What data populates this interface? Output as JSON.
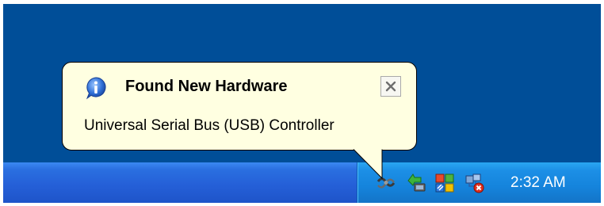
{
  "balloon": {
    "title": "Found New Hardware",
    "message": "Universal Serial Bus (USB) Controller",
    "info_icon": "info-icon",
    "close_icon": "close-icon"
  },
  "tray": {
    "icons": [
      "usb-safely-remove-icon",
      "network-connection-icon",
      "windows-security-center-icon",
      "network-error-icon"
    ],
    "clock": "2:32 AM"
  },
  "colors": {
    "desktop": "#004e98",
    "taskbar": "#2560d8",
    "tray": "#1584dc",
    "balloon": "#ffffe1"
  }
}
